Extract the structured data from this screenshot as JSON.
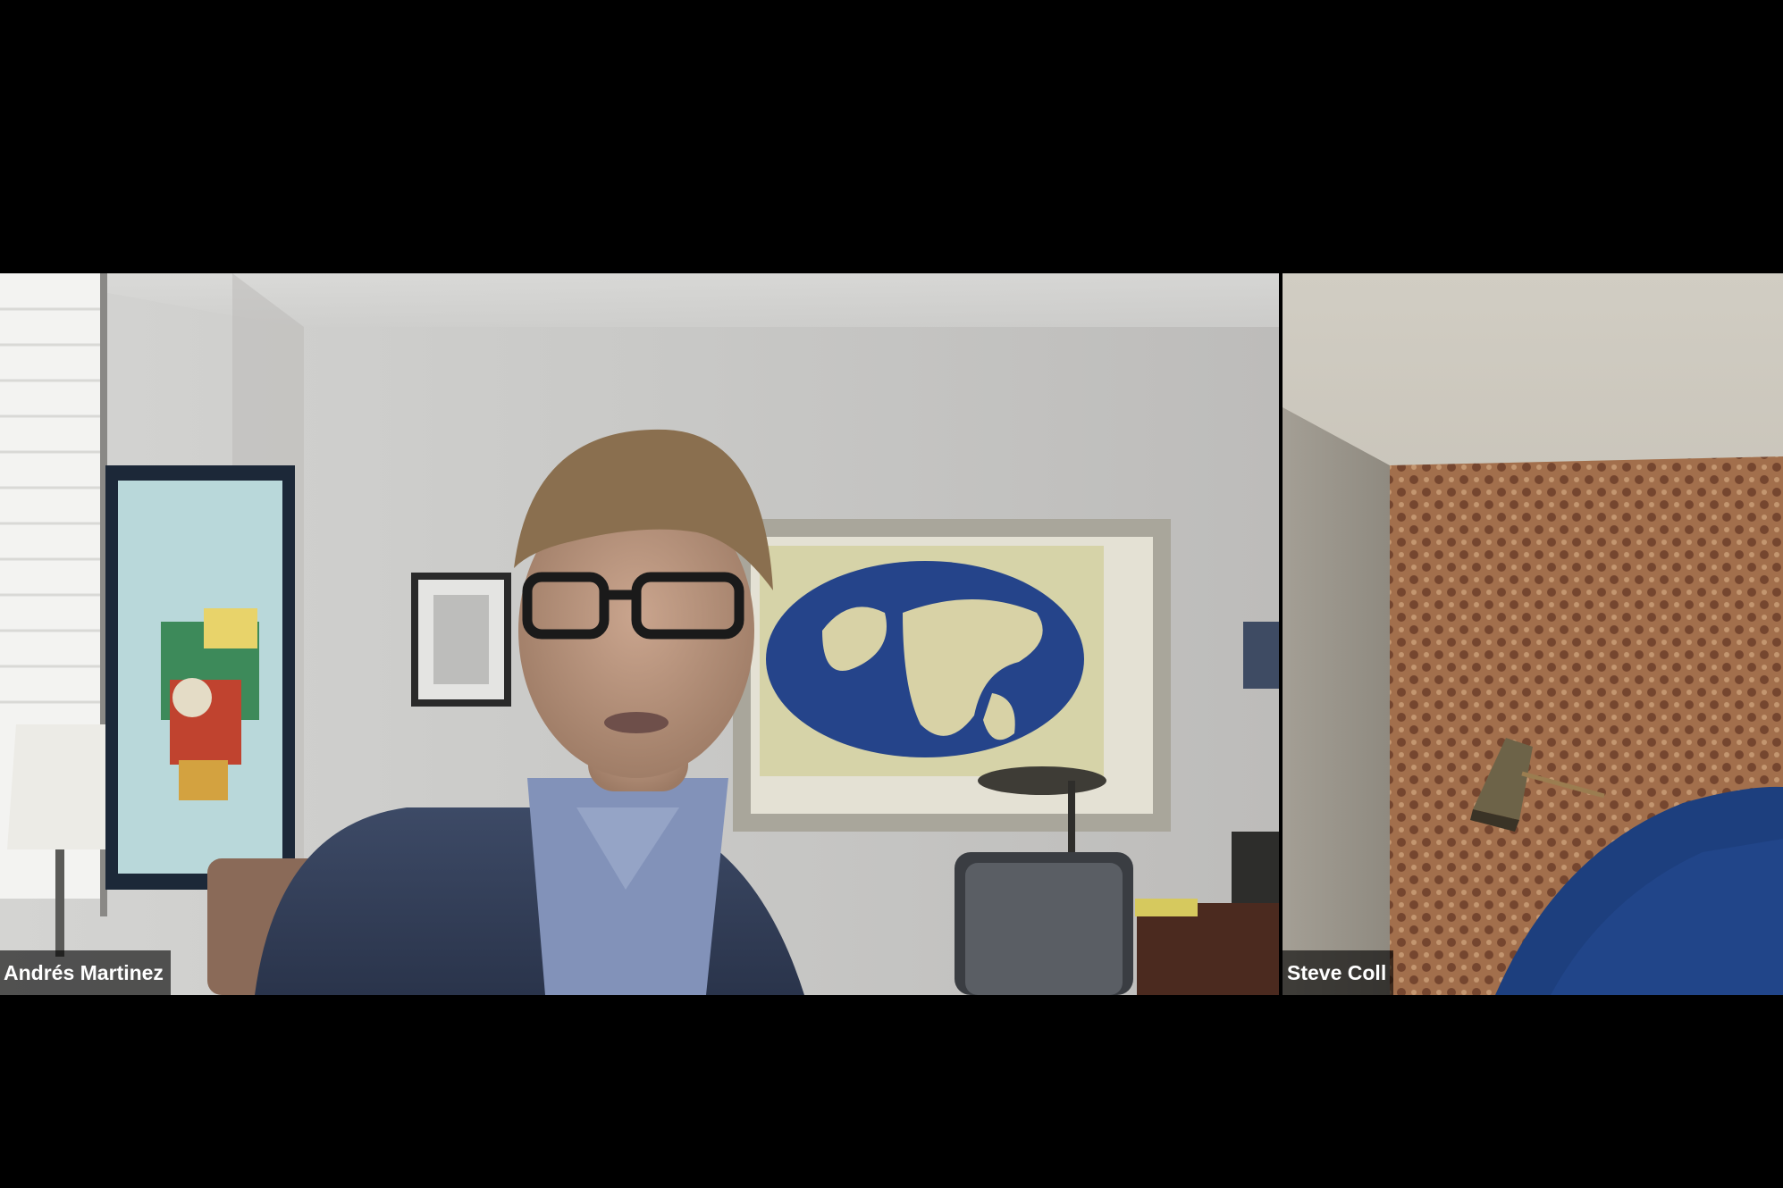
{
  "meeting": {
    "participants": [
      {
        "display_name": "Andrés Martinez",
        "state": "active-speaker",
        "video": "on"
      },
      {
        "display_name": "Steve Coll",
        "state": "listening",
        "video": "on"
      }
    ]
  },
  "colors": {
    "background": "#000000",
    "name_tag_bg": "rgba(0,0,0,0.62)",
    "name_tag_text": "#ffffff"
  }
}
